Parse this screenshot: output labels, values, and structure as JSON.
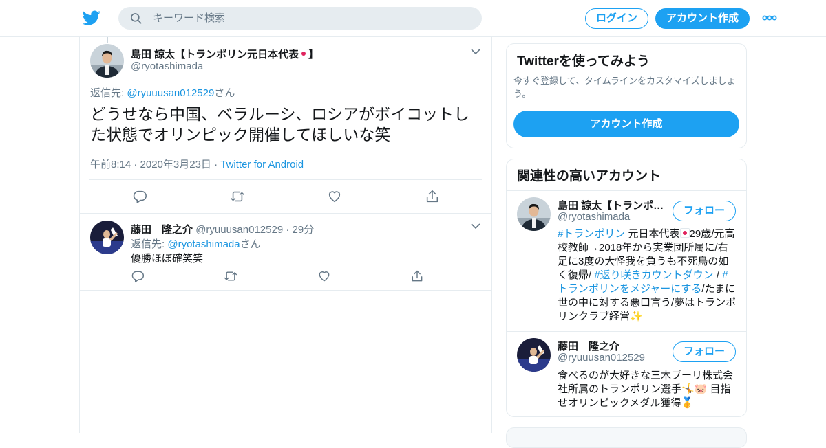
{
  "header": {
    "search_placeholder": "キーワード検索",
    "login_label": "ログイン",
    "signup_label": "アカウント作成"
  },
  "tweet": {
    "name": "島田 諒太【トランポリン元日本代表",
    "name_suffix": "】",
    "handle": "@ryotashimada",
    "reply_prefix": "返信先: ",
    "reply_mention": "@ryuuusan012529",
    "reply_suffix": "さん",
    "text": "どうせなら中国、ベラルーシ、ロシアがボイコットした状態でオリンピック開催してほしいな笑",
    "time": "午前8:14 · 2020年3月23日 · ",
    "source": "Twitter for Android"
  },
  "reply": {
    "name": "藤田　隆之介",
    "handle": "@ryuuusan012529",
    "time": " · 29分",
    "reply_prefix": "返信先: ",
    "reply_mention": "@ryotashimada",
    "reply_suffix": "さん",
    "text": "優勝ほぼ確笑笑"
  },
  "sidebar": {
    "signup_card": {
      "title": "Twitterを使ってみよう",
      "description": "今すぐ登録して、タイムラインをカスタマイズしましょう。",
      "button": "アカウント作成"
    },
    "related": {
      "title": "関連性の高いアカウント",
      "follow_label": "フォロー",
      "accounts": [
        {
          "name": "島田 諒太【トランポ…",
          "handle": "@ryotashimada",
          "bio_tag1": "#トランポリン",
          "bio_part1": " 元日本代表",
          "bio_part2": "29歳/元高校教師→2018年から実業団所属に/右足に3度の大怪我を負うも不死鳥の如く復帰/ ",
          "bio_tag2": "#返り咲きカウントダウン",
          "bio_part3": " / ",
          "bio_tag3": "#トランポリンをメジャーにする",
          "bio_part4": "/たまに世の中に対する悪口言う/夢はトランポリンクラブ経営",
          "bio_emoji": "✨"
        },
        {
          "name": "藤田　隆之介",
          "handle": "@ryuuusan012529",
          "bio_part1": "食べるのが大好きな三木プーリ株式会社所属のトランポリン選手",
          "bio_emoji1": "🤸",
          "bio_emoji2": "🐷",
          "bio_part2": " 目指せオリンピックメダル獲得",
          "bio_emoji3": "🥇"
        }
      ]
    }
  }
}
